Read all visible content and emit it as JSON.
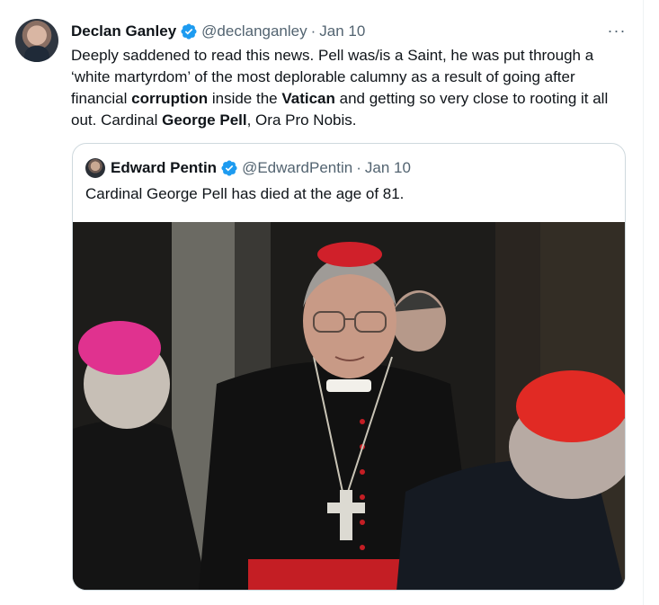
{
  "tweet": {
    "author_name": "Declan Ganley",
    "handle": "@declanganley",
    "separator": "·",
    "date": "Jan 10",
    "more_label": "···",
    "text_parts": {
      "p1": "Deeply saddened to read this news. Pell was/is a Saint, he was put through a ‘white martyrdom’ of the most deplorable calumny as a result of going after financial ",
      "b1": "corruption",
      "p2": " inside the ",
      "b2": "Vatican",
      "p3": " and getting so very close to rooting it all out. Cardinal ",
      "b3": "George Pell",
      "p4": ", Ora Pro Nobis."
    }
  },
  "quoted_tweet": {
    "author_name": "Edward Pentin",
    "handle": "@EdwardPentin",
    "separator": "·",
    "date": "Jan 10",
    "text": "Cardinal George Pell has died at the age of 81."
  },
  "colors": {
    "verified": "#1d9bf0",
    "text_primary": "#0f1419",
    "text_secondary": "#536471",
    "border": "#cfd9de"
  },
  "icons": {
    "verified": "verified-badge-icon",
    "more": "more-options-icon"
  }
}
